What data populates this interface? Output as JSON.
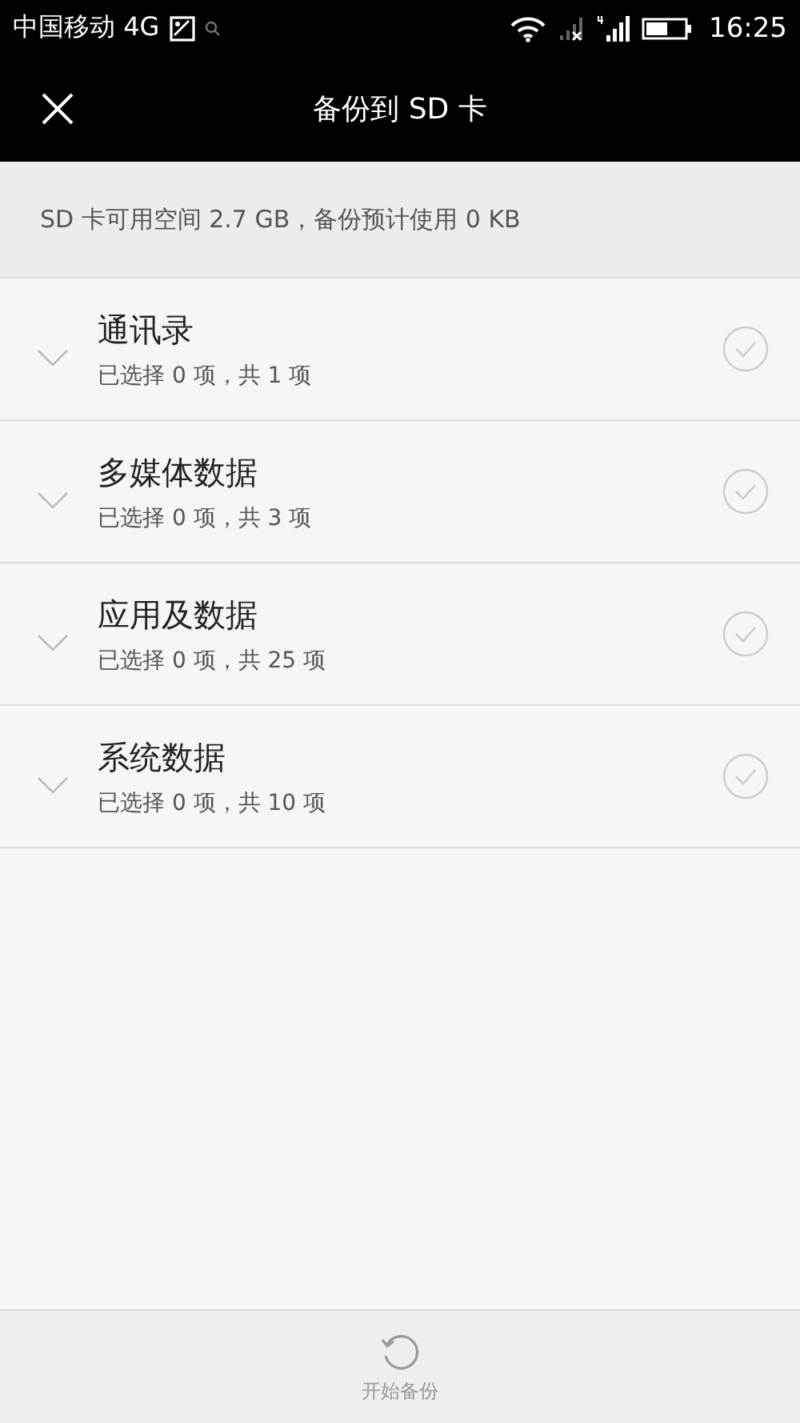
{
  "status_bar": {
    "carrier": "中国移动 4G",
    "time": "16:25"
  },
  "header": {
    "title": "备份到 SD 卡"
  },
  "storage_info": "SD 卡可用空间 2.7 GB，备份预计使用 0 KB",
  "categories": [
    {
      "name": "通讯录",
      "summary": "已选择 0 项，共 1 项",
      "checked": false,
      "expanded": false
    },
    {
      "name": "多媒体数据",
      "summary": "已选择 0 项，共 3 项",
      "checked": false,
      "expanded": false
    },
    {
      "name": "应用及数据",
      "summary": "已选择 0 项，共 25 项",
      "checked": false,
      "expanded": false
    },
    {
      "name": "系统数据",
      "summary": "已选择 0 项，共 10 项",
      "checked": false,
      "expanded": false
    }
  ],
  "bottom_action": {
    "label": "开始备份",
    "disabled": true
  }
}
